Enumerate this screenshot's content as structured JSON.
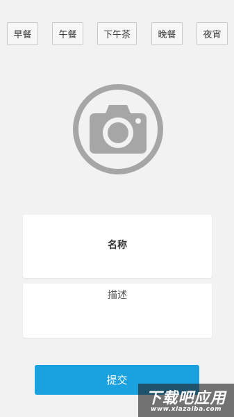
{
  "meal_tabs": [
    {
      "label": "早餐"
    },
    {
      "label": "午餐"
    },
    {
      "label": "下午茶"
    },
    {
      "label": "晚餐"
    },
    {
      "label": "夜宵"
    }
  ],
  "photo_picker": {
    "icon": "camera-icon"
  },
  "form": {
    "name_label": "名称",
    "description_label": "描述"
  },
  "submit": {
    "label": "提交"
  },
  "watermark": {
    "main": "下载吧应用",
    "sub": "www.xiazaiba.com"
  },
  "colors": {
    "background": "#f2f2f2",
    "accent": "#1aa1df",
    "icon_gray": "#a6a6a6"
  }
}
